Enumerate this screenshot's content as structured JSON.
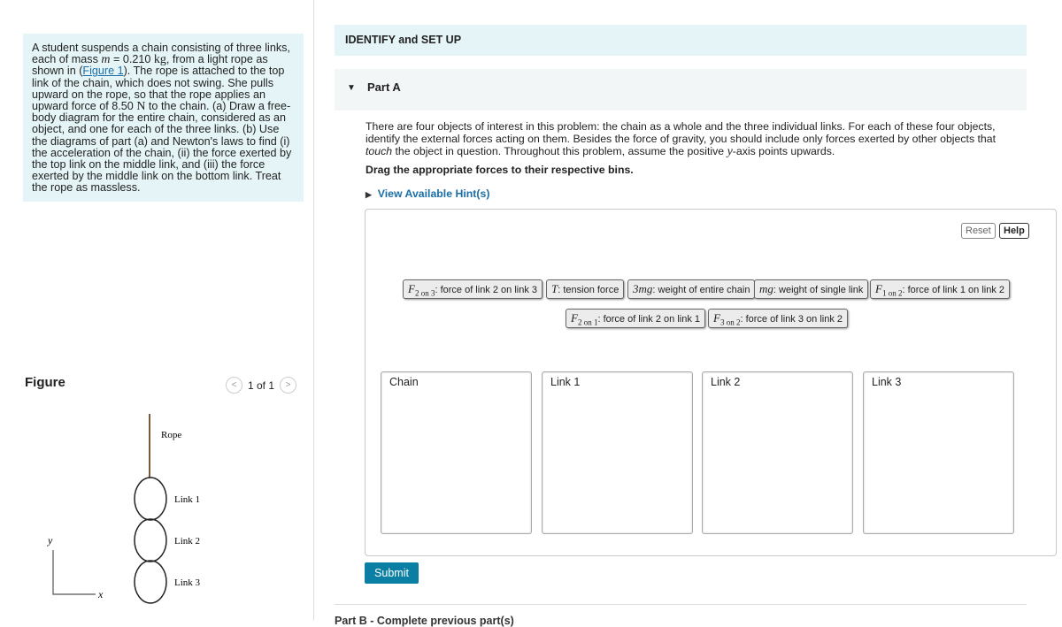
{
  "problem": {
    "p1": "A student suspends a chain consisting of three links, each of mass ",
    "var_m": "m",
    "p2": " = 0.210 ",
    "unit_kg": "kg",
    "p3": ", from a light rope as shown in (",
    "figure_link": "Figure 1",
    "p4": "). The rope is attached to the top link of the chain, which does not swing. She pulls upward on the rope, so that the rope applies an upward force of 8.50 ",
    "unit_N": "N",
    "p5": "  to the chain. (a) Draw a free-body diagram for the entire chain, considered as an object, and one for each of the three links. (b) Use the diagrams of part (a) and Newton's laws to find (i) the acceleration of the chain, (ii) the force exerted by the top link on the middle link, and (iii) the force exerted by the middle link on the bottom link. Treat the rope as massless."
  },
  "figure": {
    "heading": "Figure",
    "pager": "1 of 1",
    "labels": {
      "rope": "Rope",
      "link1": "Link 1",
      "link2": "Link 2",
      "link3": "Link 3",
      "y": "y",
      "x": "x"
    }
  },
  "identify": "IDENTIFY and SET UP",
  "part_a": {
    "label": "Part A",
    "intro1": "There are four objects of interest in this problem: the chain as a whole and the three individual links. For each of these four objects, identify the external forces acting on them. Besides the force of gravity, you should include only forces exerted by other objects that ",
    "intro_em": "touch",
    "intro2": " the object in question. Throughout this problem, assume the positive ",
    "intro_y": "y",
    "intro3": "-axis points upwards.",
    "instruction": "Drag the appropriate forces to their respective bins.",
    "hint": "View Available Hint(s)"
  },
  "buttons": {
    "reset": "Reset",
    "help": "Help",
    "submit": "Submit"
  },
  "chips": [
    {
      "sym": "F",
      "sub": "2 on 3",
      "text": ": force of link 2 on link 3"
    },
    {
      "sym": "T",
      "sub": "",
      "text": ": tension force"
    },
    {
      "sym": "3mg",
      "sub": "",
      "text": ": weight of entire chain"
    },
    {
      "sym": "mg",
      "sub": "",
      "text": ": weight of single link"
    },
    {
      "sym": "F",
      "sub": "1 on 2",
      "text": ": force of link 1 on link 2"
    },
    {
      "sym": "F",
      "sub": "2 on 1",
      "text": ": force of link 2 on link 1"
    },
    {
      "sym": "F",
      "sub": "3 on 2",
      "text": ": force of link 3 on link 2"
    }
  ],
  "bins": [
    "Chain",
    "Link 1",
    "Link 2",
    "Link 3"
  ],
  "part_b": "Part B - Complete previous part(s)",
  "colors": {
    "accent": "#0b7fa3",
    "panel": "#e5f5f7",
    "link": "#1a6ea8"
  }
}
